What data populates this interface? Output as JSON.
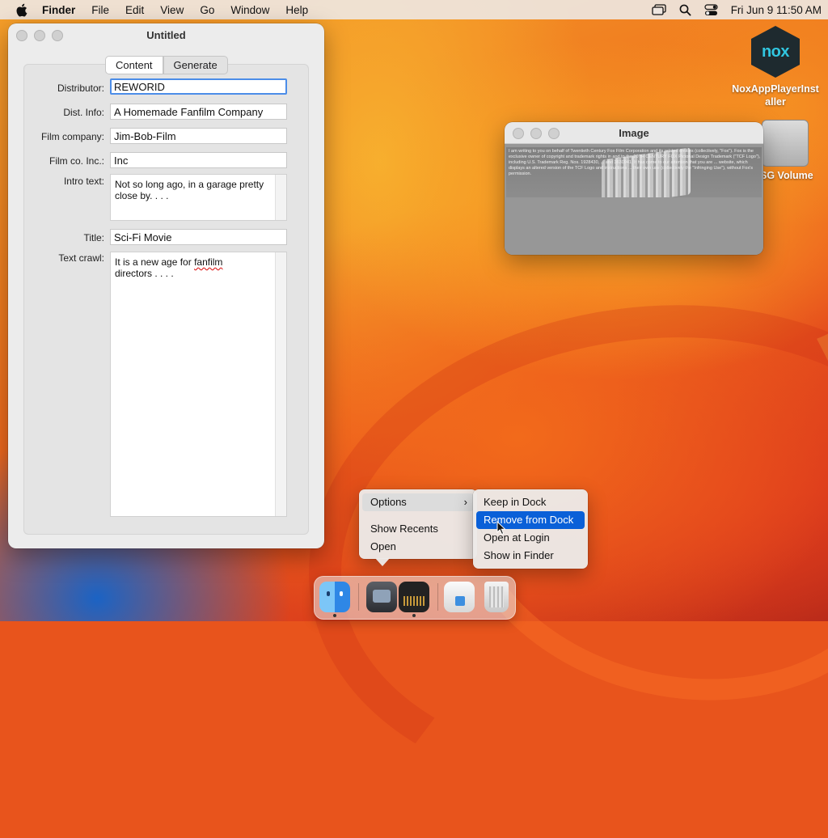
{
  "menubar": {
    "app_name": "Finder",
    "items": [
      "File",
      "Edit",
      "View",
      "Go",
      "Window",
      "Help"
    ],
    "clock": "Fri Jun 9  11:50 AM",
    "status_icons": [
      "screen-mirroring-icon",
      "search-icon",
      "control-center-icon"
    ]
  },
  "desktop": {
    "nox_label": "NoxAppPlayerInstaller",
    "nox_logo_text": "nox",
    "volume_label": "SG Volume"
  },
  "untitled_window": {
    "title": "Untitled",
    "tabs": [
      "Content",
      "Generate"
    ],
    "selected_tab": "Content",
    "fields": {
      "distributor": {
        "label": "Distributor:",
        "value": "REWORID"
      },
      "dist_info": {
        "label": "Dist. Info:",
        "value": "A Homemade Fanfilm Company"
      },
      "film_company": {
        "label": "Film company:",
        "value": "Jim-Bob-Film"
      },
      "film_co_inc": {
        "label": "Film co. Inc.:",
        "value": "Inc"
      },
      "intro_text": {
        "label": "Intro text:",
        "value": "Not so long ago, in a garage pretty close by. . . ."
      },
      "title": {
        "label": "Title:",
        "value": "Sci-Fi Movie"
      },
      "text_crawl": {
        "label": "Text crawl:",
        "line1_prefix": "It is a new age for ",
        "line1_misspelled": "fanfilm",
        "line2": "directors . . . ."
      }
    }
  },
  "image_window": {
    "title": "Image",
    "body_text": "I am writing to you on behalf of Twentieth Century Fox Film Corporation and its related entities (collectively, \"Fox\"). Fox is the exclusive owner of copyright and trademark rights in and to the 20TH CENTURY FOX Pictorial Design Trademark (\"TCF Logo\"), including U.S. Trademark Reg. Nos. 1928430, ... and 3630941. It has come to our attention that you are ... website, which displays an altered version of the TCF Logo and instructions ... their own use (collectively the \"Infringing Use\"), without Fox's permission."
  },
  "dock_menu": {
    "items": [
      "Options",
      "Show Recents",
      "Open"
    ],
    "highlighted": "Options",
    "submenu": {
      "items": [
        "Keep in Dock",
        "Remove from Dock",
        "Open at Login",
        "Show in Finder"
      ],
      "selected": "Remove from Dock"
    }
  },
  "dock": {
    "apps": [
      "finder-icon",
      "app-icon",
      "text-editor-icon",
      "preview-icon",
      "trash-icon"
    ]
  },
  "colors": {
    "selection_blue": "#0a60d8",
    "focus_ring": "#4c8de8",
    "nox_accent": "#31c6e0"
  }
}
